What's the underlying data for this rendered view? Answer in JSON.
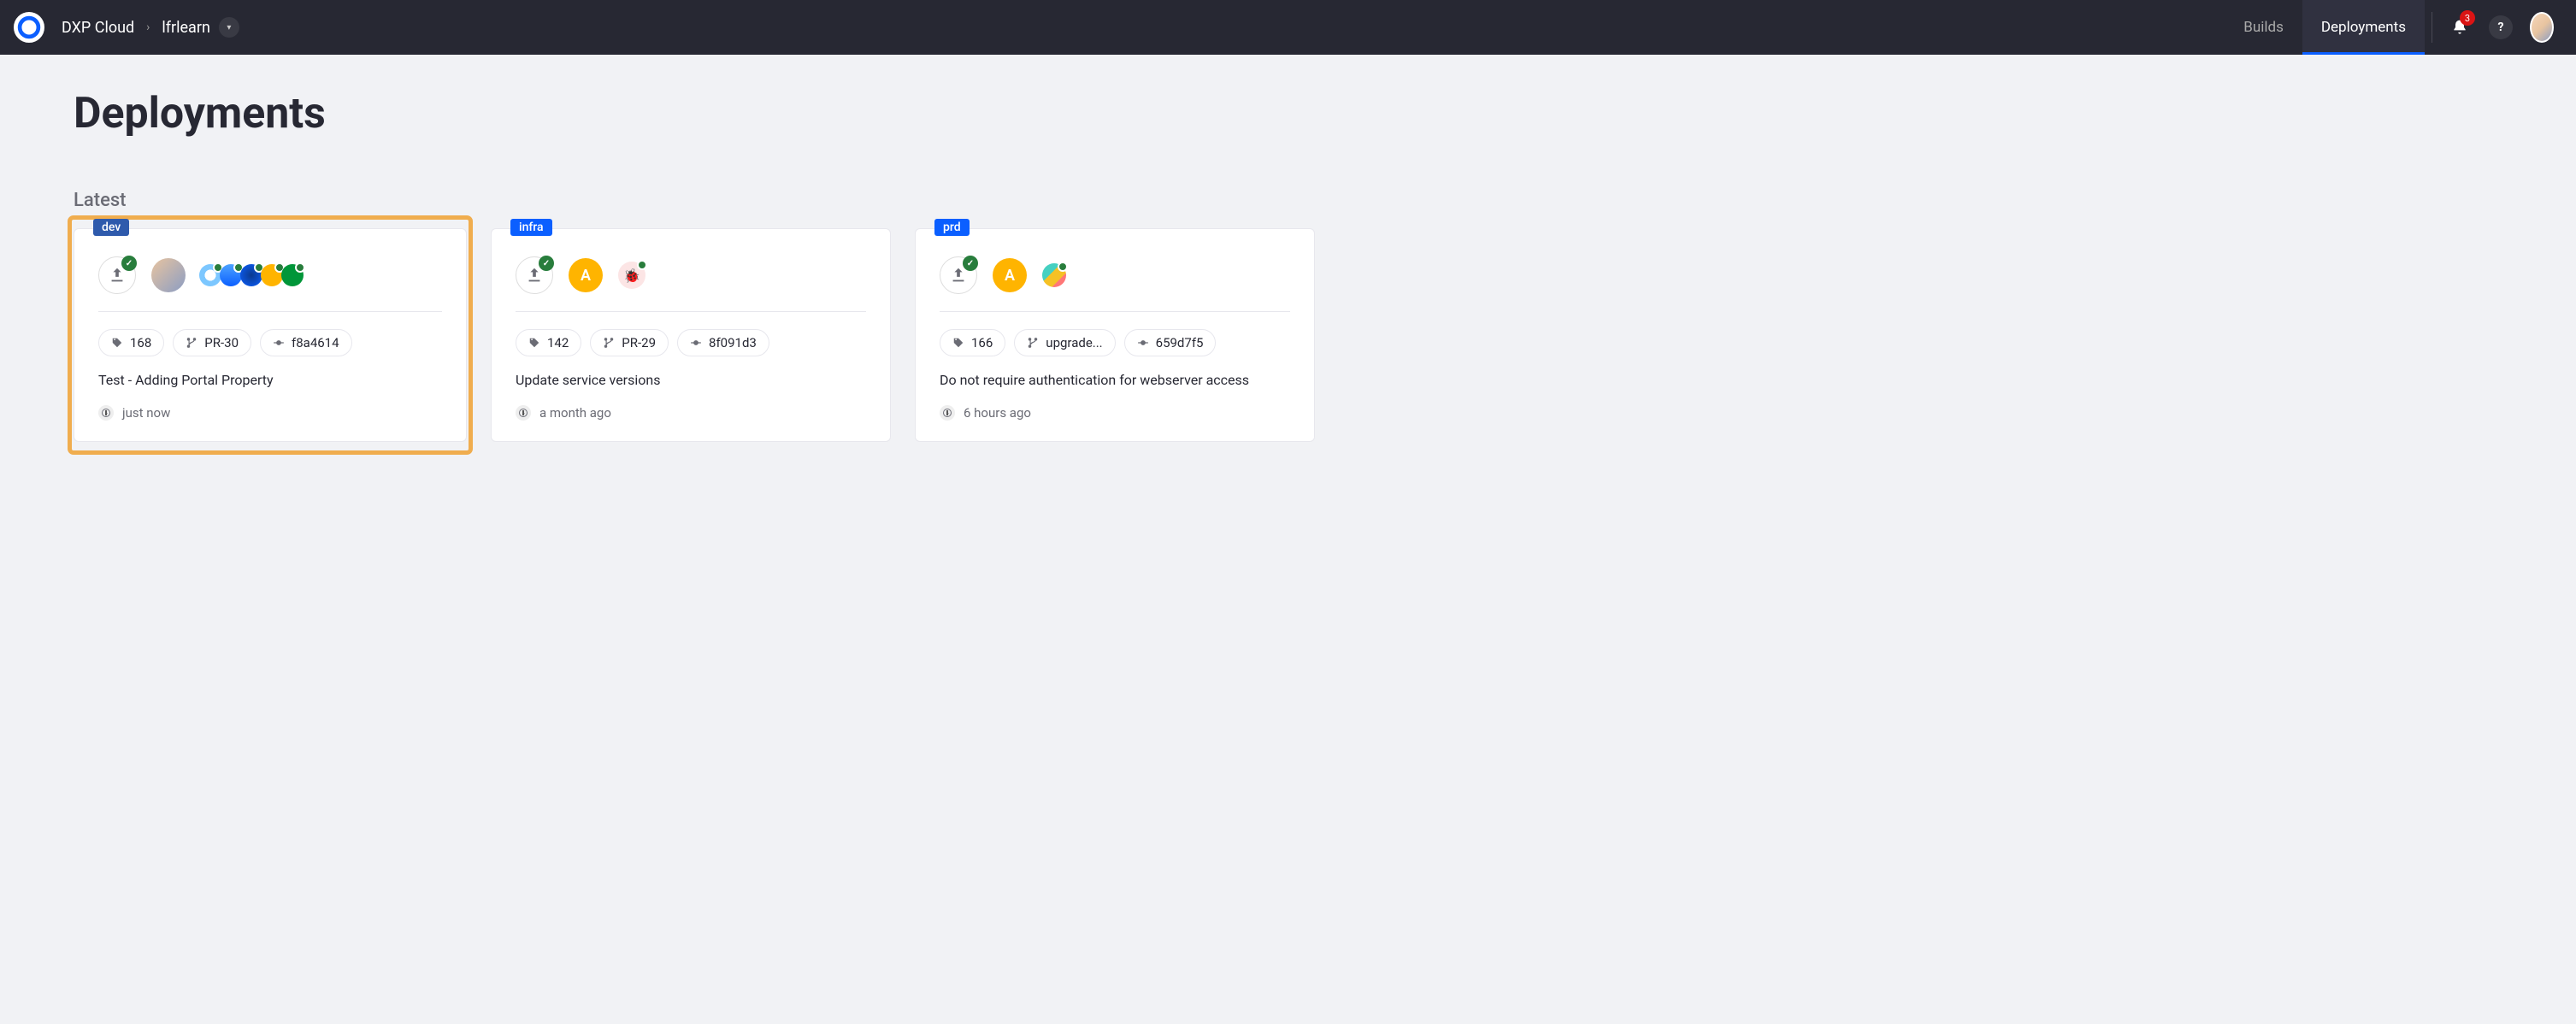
{
  "nav": {
    "product": "DXP Cloud",
    "project": "lfrlearn",
    "tabs": {
      "builds": "Builds",
      "deployments": "Deployments"
    },
    "notification_count": "3",
    "help": "?"
  },
  "page": {
    "title": "Deployments",
    "section": "Latest"
  },
  "cards": [
    {
      "env": "dev",
      "build": "168",
      "branch": "PR-30",
      "commit": "f8a4614",
      "message": "Test - Adding Portal Property",
      "time": "just now"
    },
    {
      "env": "infra",
      "user_letter": "A",
      "build": "142",
      "branch": "PR-29",
      "commit": "8f091d3",
      "message": "Update service versions",
      "time": "a month ago"
    },
    {
      "env": "prd",
      "user_letter": "A",
      "build": "166",
      "branch": "upgrade...",
      "commit": "659d7f5",
      "message": "Do not require authentication for webserver access",
      "time": "6 hours ago"
    }
  ]
}
